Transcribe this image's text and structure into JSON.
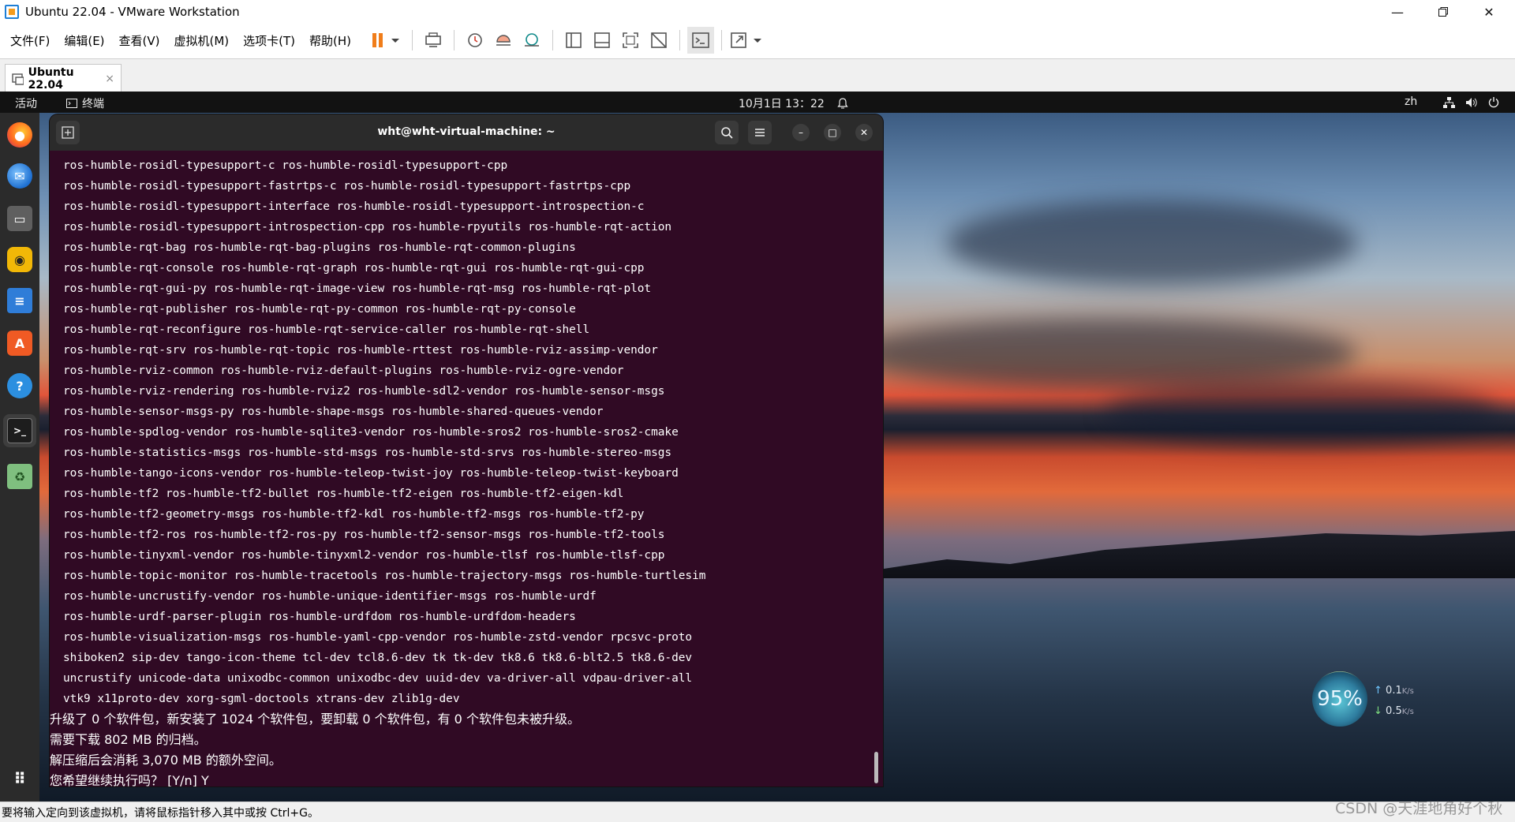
{
  "window": {
    "title": "Ubuntu 22.04 - VMware Workstation"
  },
  "menu": [
    "文件(F)",
    "编辑(E)",
    "查看(V)",
    "虚拟机(M)",
    "选项卡(T)",
    "帮助(H)"
  ],
  "tab": {
    "label": "Ubuntu 22.04",
    "close": "×"
  },
  "ubuntu_topbar": {
    "activities": "活动",
    "app": "终端",
    "clock": "10月1日 13：22",
    "lang": "zh"
  },
  "terminal": {
    "title": "wht@wht-virtual-machine: ~",
    "package_lines": [
      "ros-humble-rosidl-typesupport-c ros-humble-rosidl-typesupport-cpp",
      "ros-humble-rosidl-typesupport-fastrtps-c ros-humble-rosidl-typesupport-fastrtps-cpp",
      "ros-humble-rosidl-typesupport-interface ros-humble-rosidl-typesupport-introspection-c",
      "ros-humble-rosidl-typesupport-introspection-cpp ros-humble-rpyutils ros-humble-rqt-action",
      "ros-humble-rqt-bag ros-humble-rqt-bag-plugins ros-humble-rqt-common-plugins",
      "ros-humble-rqt-console ros-humble-rqt-graph ros-humble-rqt-gui ros-humble-rqt-gui-cpp",
      "ros-humble-rqt-gui-py ros-humble-rqt-image-view ros-humble-rqt-msg ros-humble-rqt-plot",
      "ros-humble-rqt-publisher ros-humble-rqt-py-common ros-humble-rqt-py-console",
      "ros-humble-rqt-reconfigure ros-humble-rqt-service-caller ros-humble-rqt-shell",
      "ros-humble-rqt-srv ros-humble-rqt-topic ros-humble-rttest ros-humble-rviz-assimp-vendor",
      "ros-humble-rviz-common ros-humble-rviz-default-plugins ros-humble-rviz-ogre-vendor",
      "ros-humble-rviz-rendering ros-humble-rviz2 ros-humble-sdl2-vendor ros-humble-sensor-msgs",
      "ros-humble-sensor-msgs-py ros-humble-shape-msgs ros-humble-shared-queues-vendor",
      "ros-humble-spdlog-vendor ros-humble-sqlite3-vendor ros-humble-sros2 ros-humble-sros2-cmake",
      "ros-humble-statistics-msgs ros-humble-std-msgs ros-humble-std-srvs ros-humble-stereo-msgs",
      "ros-humble-tango-icons-vendor ros-humble-teleop-twist-joy ros-humble-teleop-twist-keyboard",
      "ros-humble-tf2 ros-humble-tf2-bullet ros-humble-tf2-eigen ros-humble-tf2-eigen-kdl",
      "ros-humble-tf2-geometry-msgs ros-humble-tf2-kdl ros-humble-tf2-msgs ros-humble-tf2-py",
      "ros-humble-tf2-ros ros-humble-tf2-ros-py ros-humble-tf2-sensor-msgs ros-humble-tf2-tools",
      "ros-humble-tinyxml-vendor ros-humble-tinyxml2-vendor ros-humble-tlsf ros-humble-tlsf-cpp",
      "ros-humble-topic-monitor ros-humble-tracetools ros-humble-trajectory-msgs ros-humble-turtlesim",
      "ros-humble-uncrustify-vendor ros-humble-unique-identifier-msgs ros-humble-urdf",
      "ros-humble-urdf-parser-plugin ros-humble-urdfdom ros-humble-urdfdom-headers",
      "ros-humble-visualization-msgs ros-humble-yaml-cpp-vendor ros-humble-zstd-vendor rpcsvc-proto",
      "shiboken2 sip-dev tango-icon-theme tcl-dev tcl8.6-dev tk tk-dev tk8.6 tk8.6-blt2.5 tk8.6-dev",
      "uncrustify unicode-data unixodbc-common unixodbc-dev uuid-dev va-driver-all vdpau-driver-all",
      "vtk9 x11proto-dev xorg-sgml-doctools xtrans-dev zlib1g-dev"
    ],
    "summary_lines": [
      "升级了 0 个软件包，新安装了 1024 个软件包，要卸载 0 个软件包，有 0 个软件包未被升级。",
      "需要下载 802 MB 的归档。",
      "解压缩后会消耗 3,070 MB 的额外空间。",
      "您希望继续执行吗？ [Y/n] Y"
    ]
  },
  "speed_widget": {
    "percent": "95%",
    "up": "0.1",
    "up_unit": "K/s",
    "down": "0.5",
    "down_unit": "K/s"
  },
  "statusbar": {
    "text": "要将输入定向到该虚拟机，请将鼠标指针移入其中或按 Ctrl+G。"
  },
  "watermark": "CSDN @天涯地角好个秋",
  "colors": {
    "terminal_bg": "#300a24",
    "topbar_bg": "#121212",
    "dock_bg": "#2b2b2b"
  }
}
